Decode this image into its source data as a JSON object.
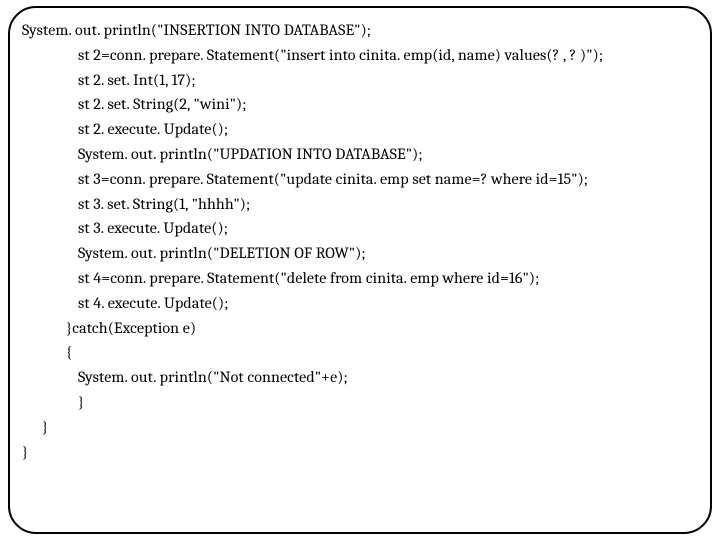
{
  "code": {
    "lines": [
      {
        "indent": "l0",
        "text": "System. out. println(\"INSERTION INTO DATABASE\");"
      },
      {
        "indent": "l1",
        "text": "st 2=conn. prepare. Statement(\"insert into cinita. emp(id, name) values(? , ? )\");"
      },
      {
        "indent": "l1",
        "text": "st 2. set. Int(1, 17);"
      },
      {
        "indent": "l1",
        "text": "st 2. set. String(2, \"wini\");"
      },
      {
        "indent": "l1",
        "text": "st 2. execute. Update();"
      },
      {
        "indent": "l1",
        "text": "System. out. println(\"UPDATION INTO DATABASE\");"
      },
      {
        "indent": "l1",
        "text": "st 3=conn. prepare. Statement(\"update cinita. emp set name=? where id=15\");"
      },
      {
        "indent": "l1",
        "text": "st 3. set. String(1, \"hhhh\");"
      },
      {
        "indent": "l1",
        "text": "st 3. execute. Update();"
      },
      {
        "indent": "l1",
        "text": "System. out. println(\"DELETION OF ROW\");"
      },
      {
        "indent": "l1",
        "text": "st 4=conn. prepare. Statement(\"delete from cinita. emp where id=16\");"
      },
      {
        "indent": "l1",
        "text": "st 4. execute. Update();"
      },
      {
        "indent": "l2",
        "text": "}catch(Exception e)"
      },
      {
        "indent": "l2",
        "text": "{"
      },
      {
        "indent": "l1",
        "text": "System. out. println(\"Not connected\"+e);"
      },
      {
        "indent": "l1",
        "text": "}"
      },
      {
        "indent": "l3",
        "text": "}"
      },
      {
        "indent": "l0",
        "text": "}"
      }
    ]
  }
}
